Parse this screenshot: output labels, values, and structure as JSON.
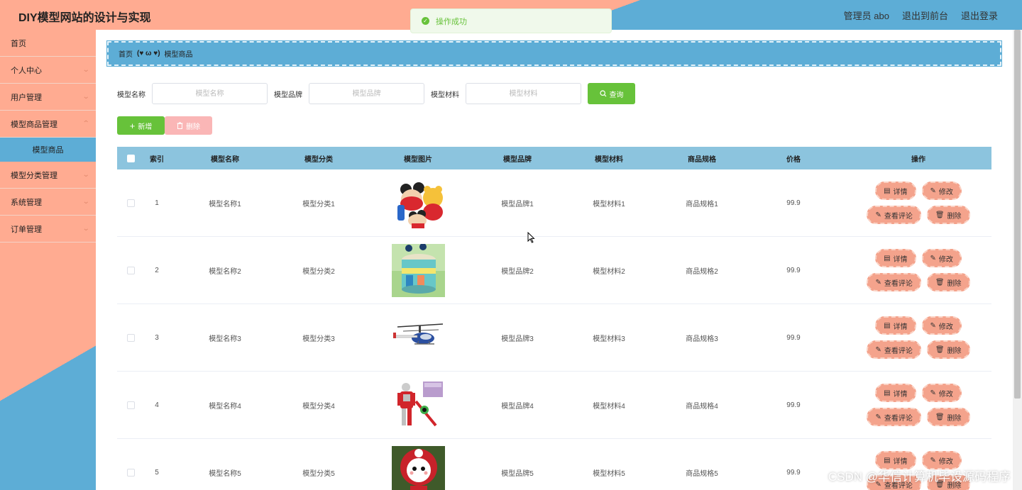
{
  "header": {
    "title": "DIY模型网站的设计与实现",
    "user": "管理员 abo",
    "to_front": "退出到前台",
    "logout": "退出登录"
  },
  "toast": {
    "message": "操作成功"
  },
  "sidebar": {
    "items": [
      {
        "label": "首页",
        "has_children": false
      },
      {
        "label": "个人中心",
        "has_children": true
      },
      {
        "label": "用户管理",
        "has_children": true
      },
      {
        "label": "模型商品管理",
        "has_children": true
      },
      {
        "label": "模型商品",
        "sub": true
      },
      {
        "label": "模型分类管理",
        "has_children": true
      },
      {
        "label": "系统管理",
        "has_children": true
      },
      {
        "label": "订单管理",
        "has_children": true
      }
    ]
  },
  "breadcrumb": {
    "home": "首页",
    "separator": "(♥ ω ♥)",
    "current": "模型商品"
  },
  "search": {
    "name_label": "模型名称",
    "name_placeholder": "模型名称",
    "brand_label": "模型品牌",
    "brand_placeholder": "模型品牌",
    "material_label": "模型材料",
    "material_placeholder": "模型材料",
    "query_label": "查询"
  },
  "actions": {
    "add_label": "新增",
    "delete_label": "删除"
  },
  "table": {
    "headers": [
      "索引",
      "模型名称",
      "模型分类",
      "模型图片",
      "模型品牌",
      "模型材料",
      "商品规格",
      "价格",
      "操作"
    ],
    "ops": {
      "detail": "详情",
      "edit": "修改",
      "comments": "查看评论",
      "delete": "删除"
    },
    "rows": [
      {
        "index": "1",
        "name": "模型名称1",
        "category": "模型分类1",
        "image": "mickey-backpack",
        "brand": "模型品牌1",
        "material": "模型材料1",
        "spec": "商品规格1",
        "price": "99.9"
      },
      {
        "index": "2",
        "name": "模型名称2",
        "category": "模型分类2",
        "image": "green-jar-toy",
        "brand": "模型品牌2",
        "material": "模型材料2",
        "spec": "商品规格2",
        "price": "99.9"
      },
      {
        "index": "3",
        "name": "模型名称3",
        "category": "模型分类3",
        "image": "rc-helicopter",
        "brand": "模型品牌3",
        "material": "模型材料3",
        "spec": "商品规格3",
        "price": "99.9"
      },
      {
        "index": "4",
        "name": "模型名称4",
        "category": "模型分类4",
        "image": "ultraman-figure",
        "brand": "模型品牌4",
        "material": "模型材料4",
        "spec": "商品规格4",
        "price": "99.9"
      },
      {
        "index": "5",
        "name": "模型名称5",
        "category": "模型分类5",
        "image": "red-hood-doll",
        "brand": "模型品牌5",
        "material": "模型材料5",
        "spec": "商品规格5",
        "price": "99.9"
      }
    ]
  },
  "watermark": "CSDN @华信计算机毕设源码程序",
  "colors": {
    "salmon": "#ffab91",
    "blue": "#5dadd6",
    "green": "#67c23a",
    "op_button": "#f4a38c"
  }
}
